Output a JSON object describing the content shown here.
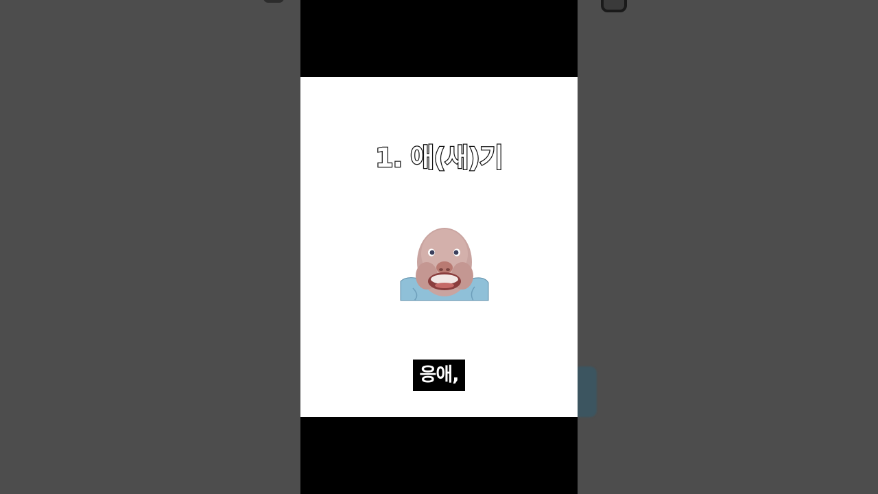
{
  "video": {
    "title": "1. 애(새)기",
    "subtitle": "응애,",
    "sticker_icon": "baby-face-icon"
  },
  "colors": {
    "background": "#4d4d4d",
    "letterbox": "#000000",
    "frame": "#ffffff",
    "title_fill": "#ffffff",
    "title_stroke": "#111111",
    "subtitle_bg": "#000000",
    "subtitle_text": "#ffffff"
  }
}
